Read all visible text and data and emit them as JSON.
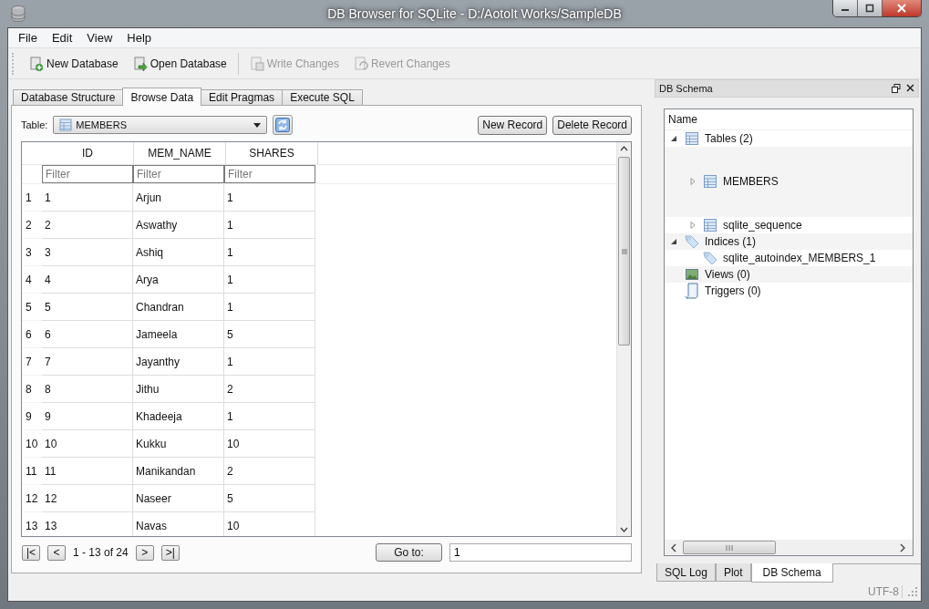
{
  "window": {
    "title": "DB Browser for SQLite - D:/AotoIt Works/SampleDB"
  },
  "menu": [
    "File",
    "Edit",
    "View",
    "Help"
  ],
  "toolbar": [
    {
      "label": "New Database",
      "kind": "new",
      "disabled": false
    },
    {
      "label": "Open Database",
      "kind": "open",
      "disabled": false
    },
    {
      "label": "Write Changes",
      "kind": "write",
      "disabled": true
    },
    {
      "label": "Revert Changes",
      "kind": "revert",
      "disabled": true
    }
  ],
  "tabs": [
    {
      "label": "Database Structure",
      "selected": false
    },
    {
      "label": "Browse Data",
      "selected": true
    },
    {
      "label": "Edit Pragmas",
      "selected": false
    },
    {
      "label": "Execute SQL",
      "selected": false
    }
  ],
  "browse": {
    "table_label": "Table:",
    "table_value": "MEMBERS",
    "new_button": "New Record",
    "delete_button": "Delete Record",
    "columns": [
      "ID",
      "MEM_NAME",
      "SHARES"
    ],
    "filters": [
      {
        "placeholder": "Filter"
      },
      {
        "placeholder": "Filter"
      },
      {
        "placeholder": "Filter"
      }
    ],
    "rows": [
      {
        "number": "1",
        "cells": [
          "1",
          "Arjun",
          "1"
        ]
      },
      {
        "number": "2",
        "cells": [
          "2",
          "Aswathy",
          "1"
        ]
      },
      {
        "number": "3",
        "cells": [
          "3",
          "Ashiq",
          "1"
        ]
      },
      {
        "number": "4",
        "cells": [
          "4",
          "Arya",
          "1"
        ]
      },
      {
        "number": "5",
        "cells": [
          "5",
          "Chandran",
          "1"
        ]
      },
      {
        "number": "6",
        "cells": [
          "6",
          "Jameela",
          "5"
        ]
      },
      {
        "number": "7",
        "cells": [
          "7",
          "Jayanthy",
          "1"
        ]
      },
      {
        "number": "8",
        "cells": [
          "8",
          "Jithu",
          "2"
        ]
      },
      {
        "number": "9",
        "cells": [
          "9",
          "Khadeeja",
          "1"
        ]
      },
      {
        "number": "10",
        "cells": [
          "10",
          "Kukku",
          "10"
        ]
      },
      {
        "number": "11",
        "cells": [
          "11",
          "Manikandan",
          "2"
        ]
      },
      {
        "number": "12",
        "cells": [
          "12",
          "Naseer",
          "5"
        ]
      },
      {
        "number": "13",
        "cells": [
          "13",
          "Navas",
          "10"
        ]
      }
    ],
    "nav": {
      "first": "|<",
      "prev": "<",
      "range": "1 - 13 of 24",
      "next": ">",
      "last": ">|",
      "goto_button": "Go to:",
      "goto_value": "1"
    }
  },
  "dock": {
    "title": "DB Schema",
    "header": "Name",
    "tree": [
      {
        "label": "Tables (2)",
        "kind": "table",
        "expanded": true,
        "children": [
          {
            "label": "MEMBERS",
            "kind": "table",
            "expanded": false,
            "tall": true
          },
          {
            "label": "sqlite_sequence",
            "kind": "table",
            "expanded": false,
            "tall": false
          }
        ]
      },
      {
        "label": "Indices (1)",
        "kind": "index",
        "expanded": true,
        "children": [
          {
            "label": "sqlite_autoindex_MEMBERS_1",
            "kind": "index"
          }
        ]
      },
      {
        "label": "Views (0)",
        "kind": "view"
      },
      {
        "label": "Triggers (0)",
        "kind": "trigger"
      }
    ],
    "tabs": [
      {
        "label": "SQL Log",
        "selected": false
      },
      {
        "label": "Plot",
        "selected": false
      },
      {
        "label": "DB Schema",
        "selected": true
      }
    ]
  },
  "status_bar": {
    "encoding": "UTF-8"
  }
}
